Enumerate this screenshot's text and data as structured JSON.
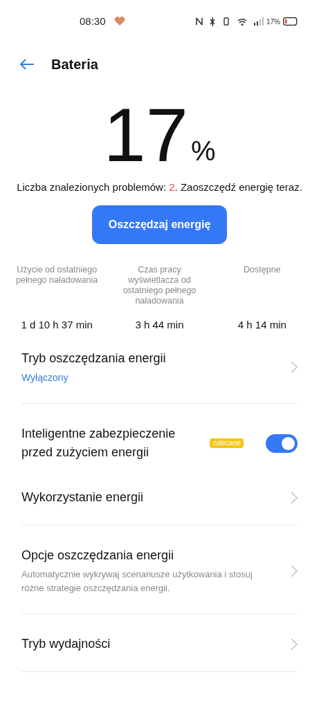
{
  "status_bar": {
    "time": "08:30",
    "battery": "17%"
  },
  "header": {
    "title": "Bateria"
  },
  "battery": {
    "value": "17",
    "unit": "%"
  },
  "problems": {
    "prefix": "Liczba znalezionych problemów: ",
    "count": "2",
    "suffix": ". Zaoszczędź energię teraz."
  },
  "save_button": {
    "label": "Oszczędzaj energię"
  },
  "stats": [
    {
      "label": "Użycie od ostatniego pełnego naładowania",
      "value": "1 d 10 h 37 min"
    },
    {
      "label": "Czas pracy wyświetlacza od ostatniego pełnego naładowania",
      "value": "3 h 44 min"
    },
    {
      "label": "Dostępne",
      "value": "4 h 14 min"
    }
  ],
  "sections": [
    [
      {
        "kind": "nav",
        "title": "Tryb oszczędzania energii",
        "status": "Wyłączony"
      }
    ],
    [
      {
        "kind": "toggle",
        "title": "Inteligentne zabezpieczenie przed zużyciem energii",
        "badge": "zalecane",
        "on": true
      },
      {
        "kind": "nav",
        "title": "Wykorzystanie energii"
      }
    ],
    [
      {
        "kind": "nav",
        "title": "Opcje oszczędzania energii",
        "description": "Automatycznie wykrywaj scenariusze użytkowania i stosuj różne strategie oszczędzania energii."
      }
    ],
    [
      {
        "kind": "nav",
        "title": "Tryb wydajności"
      }
    ]
  ]
}
